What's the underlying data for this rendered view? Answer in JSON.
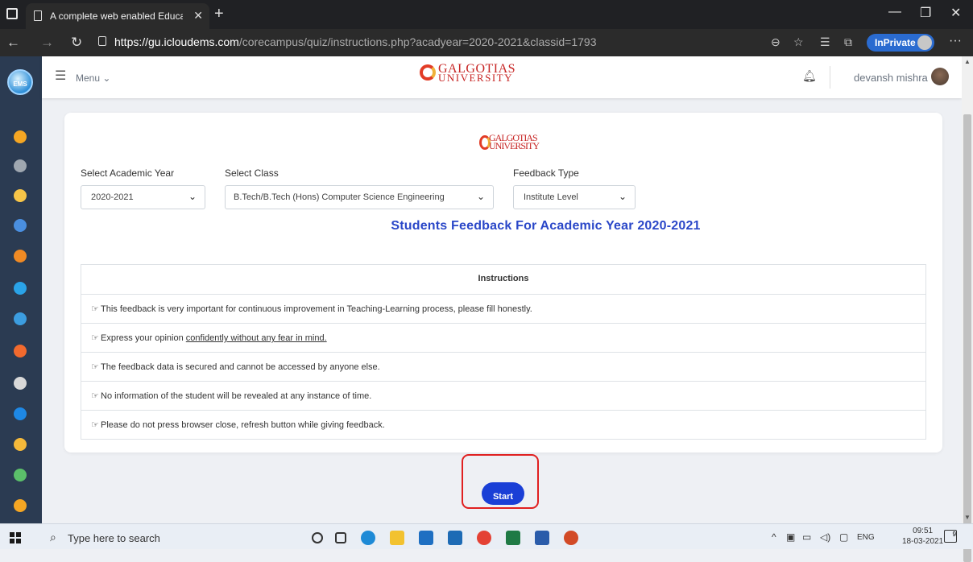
{
  "browser": {
    "tab_title": "A complete web enabled Educati",
    "url_host": "https://gu.icloudems.com",
    "url_path": "/corecampus/quiz/instructions.php?acadyear=2020-2021&classid=1793",
    "inprivate_label": "InPrivate"
  },
  "header": {
    "menu_label": "Menu ⌄",
    "logo_name_top": "GALGOTIAS",
    "logo_name_bottom": "UNIVERSITY",
    "user_name": "devansh mishra",
    "rail_logo_text": "EMS"
  },
  "form": {
    "year_label": "Select Academic Year",
    "year_value": "2020-2021",
    "class_label": "Select Class",
    "class_value": "B.Tech/B.Tech (Hons) Computer Science Engineering",
    "type_label": "Feedback Type",
    "type_value": "Institute Level"
  },
  "main": {
    "heading": "Students Feedback For Academic Year 2020-2021",
    "instructions_title": "Instructions",
    "instructions": [
      "This feedback is very important for continuous improvement in Teaching-Learning process, please fill honestly.",
      "Express your opinion ",
      "The feedback data is secured and cannot be accessed by anyone else.",
      "No information of the student will be revealed at any instance of time.",
      "Please do not press browser close, refresh button while giving feedback."
    ],
    "instruction_2_underlined": "confidently without any fear in mind.",
    "start_label": "Start"
  },
  "taskbar": {
    "search_placeholder": "Type here to search",
    "language": "ENG",
    "time": "09:51",
    "date": "18-03-2021",
    "notification_count": "9"
  },
  "colors": {
    "accent": "#1a3fd6",
    "heading": "#2a47c8",
    "highlight_border": "#e02020",
    "rail": "#2b3b52"
  }
}
